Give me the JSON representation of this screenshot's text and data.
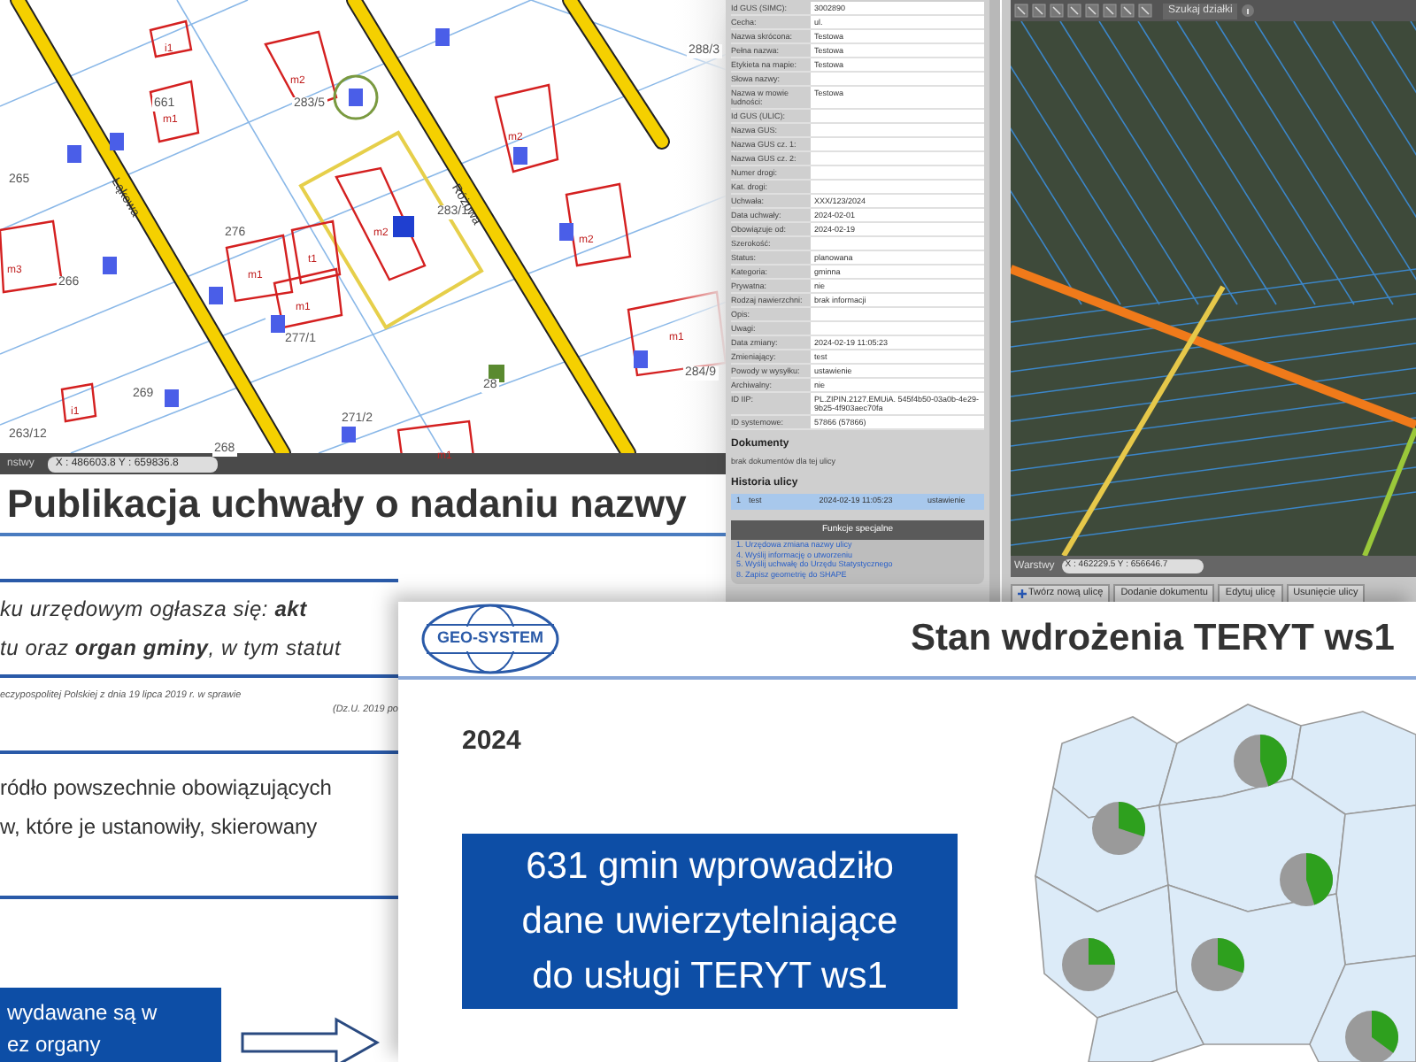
{
  "map_view": {
    "parcel_labels": [
      "661",
      "283/5",
      "265",
      "276",
      "283/1",
      "266",
      "277/1",
      "284/9",
      "28",
      "263/12",
      "268",
      "269",
      "271/2",
      "288/3"
    ],
    "building_labels": [
      "m2",
      "m1",
      "i1",
      "m3",
      "m1",
      "t1",
      "m1",
      "m2",
      "m2",
      "m1",
      "m2",
      "i1",
      "m1"
    ],
    "street_labels": [
      "Łąkowa",
      "Różowa"
    ],
    "status_bar": {
      "layers": "nstwy",
      "coordinates": "X : 486603.8  Y : 659836.8"
    }
  },
  "street_form": {
    "fields": [
      {
        "label": "Id GUS (SIMC):",
        "value": "3002890"
      },
      {
        "label": "Cecha:",
        "value": "ul."
      },
      {
        "label": "Nazwa skrócona:",
        "value": "Testowa"
      },
      {
        "label": "Pełna nazwa:",
        "value": "Testowa"
      },
      {
        "label": "Etykieta na mapie:",
        "value": "Testowa"
      },
      {
        "label": "Słowa nazwy:"
      },
      {
        "label": "Nazwa w mowie ludności:",
        "value": "Testowa"
      },
      {
        "label": "Id GUS (ULIC):"
      },
      {
        "label": "Nazwa GUS:"
      },
      {
        "label": "Nazwa GUS cz. 1:"
      },
      {
        "label": "Nazwa GUS cz. 2:"
      },
      {
        "label": "Numer drogi:"
      },
      {
        "label": "Kat. drogi:"
      },
      {
        "label": "Uchwała:",
        "value": "XXX/123/2024"
      },
      {
        "label": "Data uchwały:",
        "value": "2024-02-01"
      },
      {
        "label": "Obowiązuje od:",
        "value": "2024-02-19"
      },
      {
        "label": "Szerokość:"
      },
      {
        "label": "Status:",
        "value": "planowana"
      },
      {
        "label": "Kategoria:",
        "value": "gminna"
      },
      {
        "label": "Prywatna:",
        "value": "nie"
      },
      {
        "label": "Rodzaj nawierzchni:",
        "value": "brak informacji"
      },
      {
        "label": "Opis:"
      },
      {
        "label": "Uwagi:"
      },
      {
        "label": "Data zmiany:",
        "value": "2024-02-19 11:05:23"
      },
      {
        "label": "Zmieniający:",
        "value": "test"
      },
      {
        "label": "Powody w wysyłku:",
        "value": "ustawienie"
      },
      {
        "label": "Archiwalny:",
        "value": "nie"
      },
      {
        "label": "ID IIP:",
        "value": "PL.ZIPIN.2127.EMUiA. 545f4b50-03a0b-4e29-9b25-4f903aec70fa"
      },
      {
        "label": "ID systemowe:",
        "value": "57866 (57866)"
      }
    ],
    "documents": {
      "heading": "Dokumenty",
      "text": "brak dokumentów dla tej ulicy"
    },
    "history": {
      "heading": "Historia ulicy",
      "rows": [
        {
          "cells": [
            "1",
            "test",
            "2024-02-19 11:05:23",
            "ustawienie"
          ]
        }
      ]
    },
    "special_functions": {
      "heading": "Funkcje specjalne",
      "links": [
        "1. Urzędowa zmiana nazwy ulicy",
        "4. Wyślij informację o utworzeniu",
        "5. Wyślij uchwałę do Urzędu Statystycznego",
        "8. Zapisz geometrię do SHAPE"
      ]
    }
  },
  "aerial_view": {
    "toolbar": {
      "search_button": "Szukaj działki"
    },
    "status_bar": {
      "layers": "Warstwy",
      "coordinates": "X : 462229.5  Y : 656646.7"
    },
    "buttons": [
      "Twórz nową ulicę",
      "Dodanie dokumentu",
      "Edytuj ulicę",
      "Usunięcie ulicy"
    ]
  },
  "slide_publication": {
    "title": "Publikacja uchwały o nadaniu nazwy",
    "quote_lines": [
      "ku urzędowym ogłasza się: **akt**",
      "tu oraz **organ gminy**, w tym statut"
    ],
    "footnote_lines": [
      "eczypospolitej Polskiej z dnia 19 lipca 2019 r. w sprawie",
      "(Dz.U. 2019 po"
    ],
    "body_lines": [
      "ródło powszechnie obowiązujących",
      "w, które je ustanowiły, skierowany"
    ],
    "callout_lines": [
      "wydawane są w",
      "ez organy"
    ]
  },
  "slide_teryt": {
    "logo": "GEO-SYSTEM",
    "title": "Stan wdrożenia TERYT ws1",
    "year": "2024",
    "highlight_lines": [
      "631 gmin wprowadziło",
      "dane uwierzytelniające",
      "do usługi TERYT ws1"
    ]
  }
}
